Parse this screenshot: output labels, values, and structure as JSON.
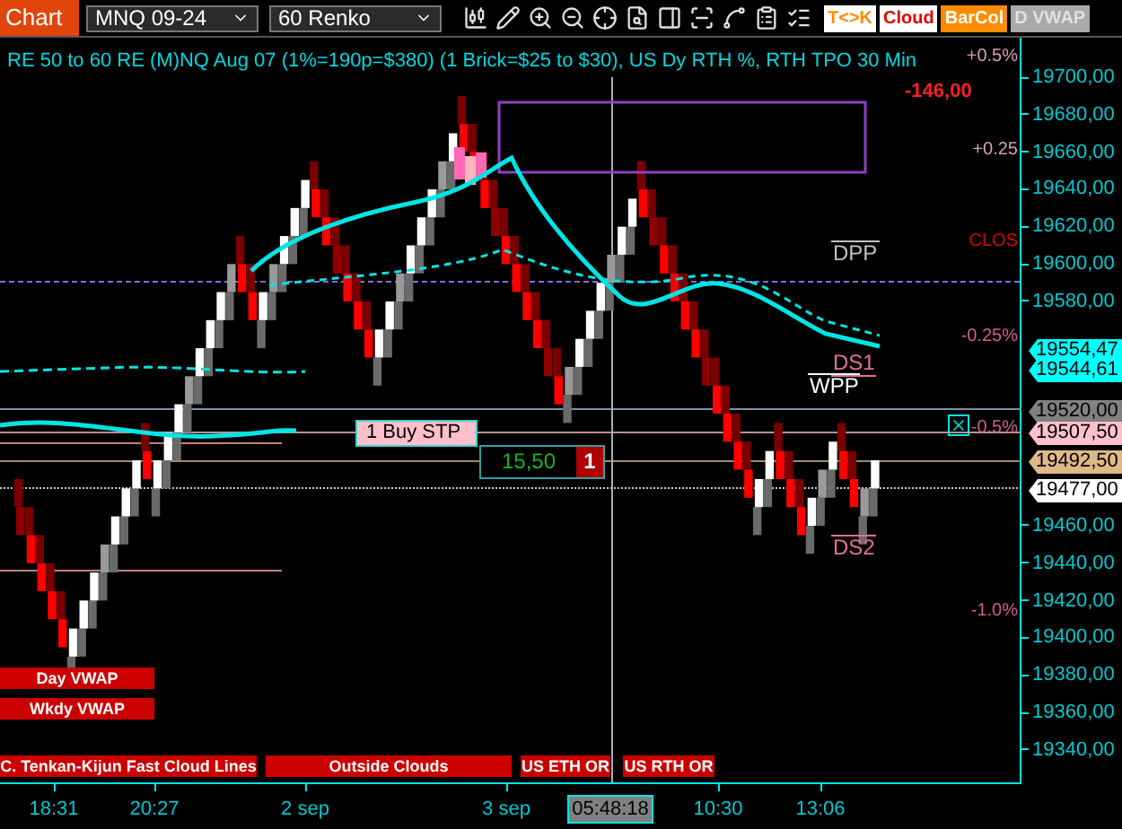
{
  "toolbar": {
    "tab": "Chart",
    "instrument": "MNQ 09-24",
    "bar_type": "60 Renko",
    "toggles": [
      {
        "label": "T<>K",
        "kind": "outline",
        "color": "#ff8c00",
        "on": true
      },
      {
        "label": "Cloud",
        "kind": "outline",
        "color": "#e00000",
        "on": true
      },
      {
        "label": "BarCol",
        "kind": "filled",
        "color": "#ff8c00",
        "on": true
      },
      {
        "label": "D VWAP",
        "kind": "filled",
        "color": "#a9a9a9",
        "on": false
      }
    ]
  },
  "chart": {
    "title": "RE 50 to 60 RE (M)NQ Aug 07 (1%=190p=$380) (1 Brick=$25 to $30), US Dy RTH %, RTH TPO 30 Min",
    "change_label": "-146,00",
    "percent_labels": [
      {
        "text": "+0.5%",
        "color": "#d8a0b0"
      },
      {
        "text": "+0.25",
        "color": "#d8a0b0"
      },
      {
        "text": "CLOS",
        "color": "#e00000"
      },
      {
        "text": "-0.25%",
        "color": "#d06090"
      },
      {
        "text": "-0.5%",
        "color": "#d06090"
      },
      {
        "text": "-1.0%",
        "color": "#d06090"
      }
    ],
    "level_labels": [
      {
        "text": "DPP",
        "color": "#c0c0c0"
      },
      {
        "text": "DS1",
        "color": "#e070a0"
      },
      {
        "text": "WPP",
        "color": "#ffffff"
      },
      {
        "text": "DS2",
        "color": "#e070a0"
      }
    ],
    "price_ticks": [
      "19700,00",
      "19680,00",
      "19660,00",
      "19640,00",
      "19620,00",
      "19600,00",
      "19580,00",
      "19460,00",
      "19440,00",
      "19420,00",
      "19400,00",
      "19380,00",
      "19360,00",
      "19340,00"
    ],
    "price_tags": [
      {
        "text": "19554,47",
        "color": "#00ffff"
      },
      {
        "text": "19544,61",
        "color": "#00ffff"
      },
      {
        "text": "19520,00",
        "color": "#808080"
      },
      {
        "text": "19507,50",
        "color": "#ffc0cb"
      },
      {
        "text": "19492,50",
        "color": "#deb887"
      },
      {
        "text": "19477,00",
        "color": "#ffffff"
      }
    ],
    "order": {
      "label": "1 Buy STP",
      "quantity": "15,50",
      "count": "1"
    },
    "indicator_labels": [
      "Day VWAP",
      "Wkdy VWAP"
    ],
    "session_labels": [
      "C. Tenkan-Kijun Fast Cloud Lines",
      "Outside Clouds",
      "US ETH OR",
      "US RTH OR"
    ],
    "time_ticks": [
      "18:31",
      "20:27",
      "2 sep",
      "3 sep",
      "10:30",
      "13:06"
    ],
    "cursor_time": "05:48:18"
  }
}
